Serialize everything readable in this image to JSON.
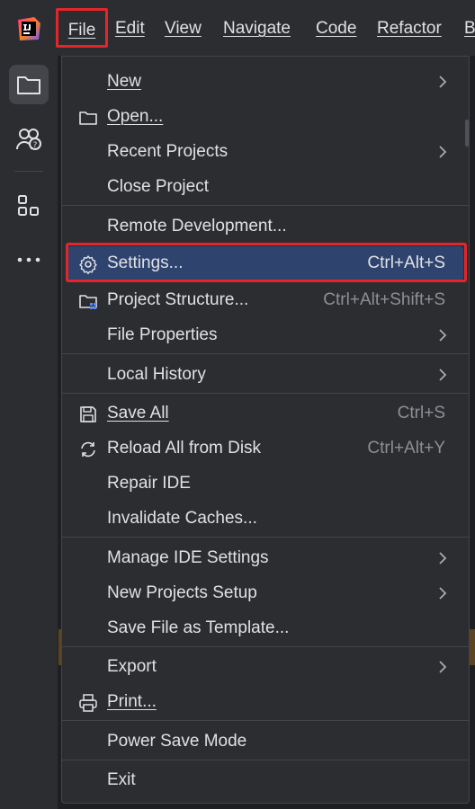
{
  "menubar": {
    "items": [
      {
        "label": "File"
      },
      {
        "label": "Edit"
      },
      {
        "label": "View"
      },
      {
        "label": "Navigate"
      },
      {
        "label": "Code"
      },
      {
        "label": "Refactor"
      },
      {
        "label": "B"
      }
    ]
  },
  "toolstrip": {
    "icons": [
      "project-folder-icon",
      "code-with-me-icon",
      "structure-icon",
      "more-icon"
    ]
  },
  "file_menu": {
    "items": [
      {
        "label": "New",
        "submenu": true,
        "icon": null
      },
      {
        "label": "Open...",
        "icon": "folder-icon"
      },
      {
        "label": "Recent Projects",
        "submenu": true
      },
      {
        "label": "Close Project"
      },
      {
        "label": "Remote Development..."
      },
      {
        "label": "Settings...",
        "shortcut": "Ctrl+Alt+S",
        "icon": "gear-icon",
        "highlighted": true
      },
      {
        "label": "Project Structure...",
        "shortcut": "Ctrl+Alt+Shift+S",
        "icon": "project-structure-icon"
      },
      {
        "label": "File Properties",
        "submenu": true
      },
      {
        "label": "Local History",
        "submenu": true
      },
      {
        "label": "Save All",
        "shortcut": "Ctrl+S",
        "icon": "save-icon"
      },
      {
        "label": "Reload All from Disk",
        "shortcut": "Ctrl+Alt+Y",
        "icon": "reload-icon"
      },
      {
        "label": "Repair IDE"
      },
      {
        "label": "Invalidate Caches..."
      },
      {
        "label": "Manage IDE Settings",
        "submenu": true
      },
      {
        "label": "New Projects Setup",
        "submenu": true
      },
      {
        "label": "Save File as Template..."
      },
      {
        "label": "Export",
        "submenu": true
      },
      {
        "label": "Print...",
        "icon": "printer-icon"
      },
      {
        "label": "Power Save Mode"
      },
      {
        "label": "Exit"
      }
    ]
  },
  "colors": {
    "background": "#2b2d30",
    "highlight": "#2e436e",
    "annotation_red": "#e5252a",
    "text": "#dfe1e5",
    "shortcut_text": "#8c8f94"
  }
}
